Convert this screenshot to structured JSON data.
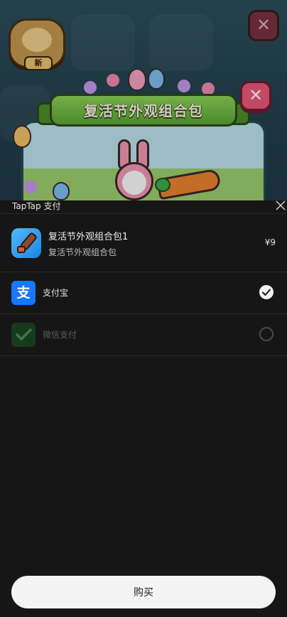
{
  "game": {
    "new_badge": "新",
    "popup_title": "复活节外观组合包"
  },
  "sheet": {
    "title": "TapTap 支付",
    "product": {
      "name": "复活节外观组合包1",
      "subtitle": "复活节外观组合包",
      "price": "¥9"
    },
    "methods": [
      {
        "label": "支付宝",
        "icon": "alipay-icon",
        "icon_glyph": "支",
        "selected": true,
        "color": "#1677ff"
      },
      {
        "label": "微信支付",
        "icon": "wechat-pay-icon",
        "selected": false,
        "enabled": false,
        "color": "#173a1d"
      }
    ],
    "buy_label": "购买"
  }
}
